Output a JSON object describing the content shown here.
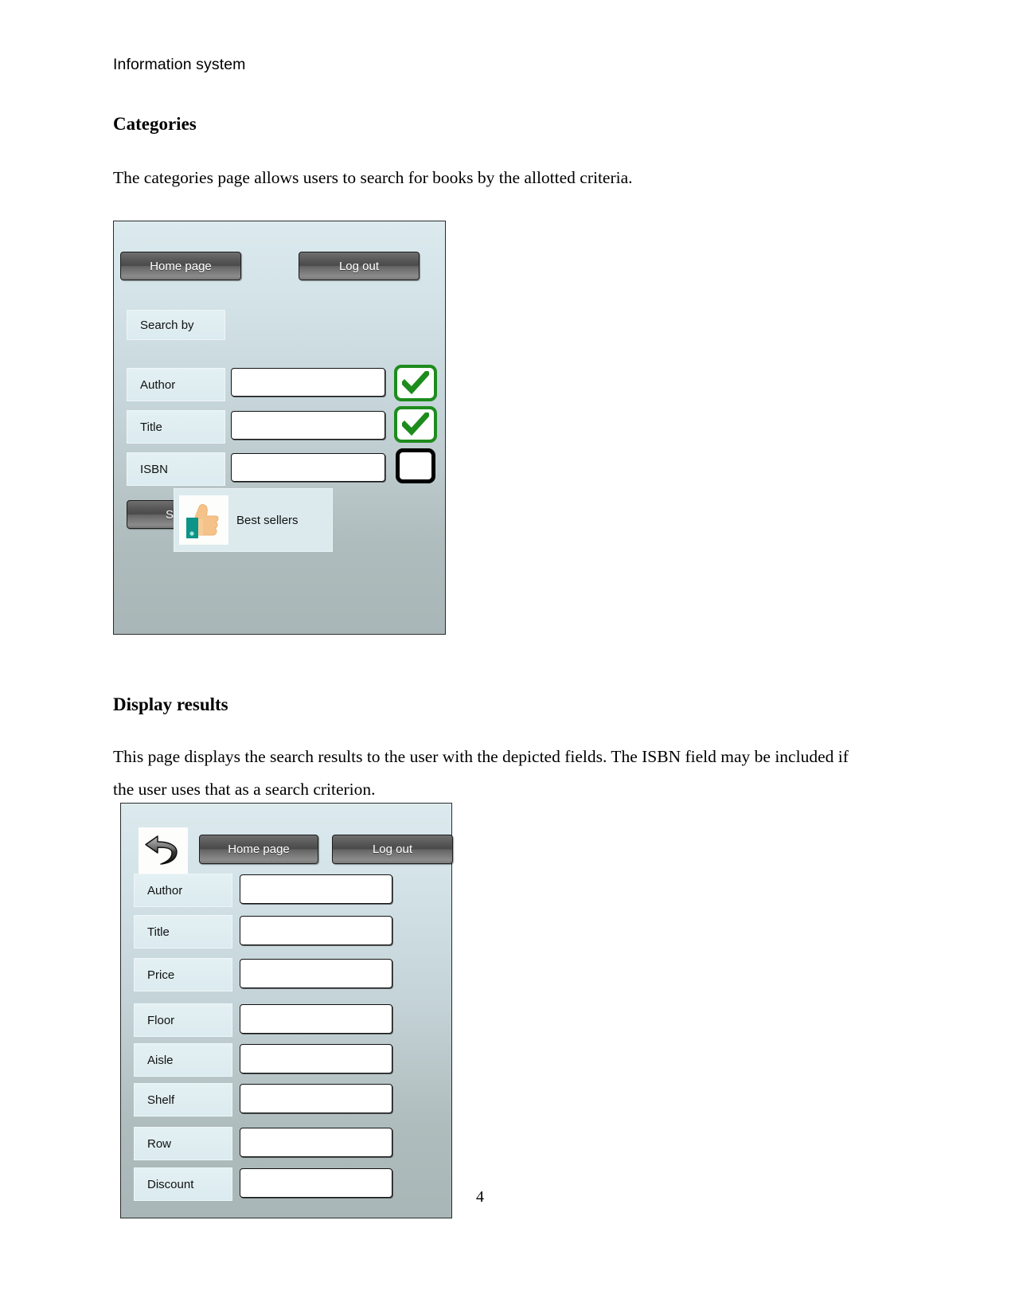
{
  "document": {
    "running_header": "Information system",
    "page_number": "4",
    "sections": [
      {
        "heading": "Categories",
        "paragraph": "The categories page allows users to search for books by the allotted criteria."
      },
      {
        "heading": "Display results",
        "paragraph": "This page displays the search results to the user with the depicted fields. The ISBN field may be included if the user uses that as a search criterion."
      }
    ]
  },
  "mockup_categories": {
    "name": "categories-screen",
    "buttons": {
      "home_page": "Home page",
      "log_out": "Log out",
      "search": "S"
    },
    "search_by_label": "Search by",
    "fields": [
      {
        "label": "Author",
        "value": "",
        "checkbox": "checked"
      },
      {
        "label": "Title",
        "value": "",
        "checkbox": "checked"
      },
      {
        "label": "ISBN",
        "value": "",
        "checkbox": "unchecked"
      }
    ],
    "best_sellers": {
      "label": "Best sellers",
      "icon": "thumbs-up-icon"
    }
  },
  "mockup_results": {
    "name": "display-results-screen",
    "back_icon": "back-arrow-icon",
    "buttons": {
      "home_page": "Home page",
      "log_out": "Log out"
    },
    "fields": [
      {
        "label": "Author",
        "value": ""
      },
      {
        "label": "Title",
        "value": ""
      },
      {
        "label": "Price",
        "value": ""
      },
      {
        "label": "Floor",
        "value": ""
      },
      {
        "label": "Aisle",
        "value": ""
      },
      {
        "label": "Shelf",
        "value": ""
      },
      {
        "label": "Row",
        "value": ""
      },
      {
        "label": "Discount",
        "value": ""
      }
    ]
  },
  "colors": {
    "panel_top": "#dceaee",
    "panel_bottom": "#a9b6b7",
    "chip": "#dfeef2",
    "button_dark": "#555555",
    "check_green": "#1d8c1d",
    "check_black": "#000000",
    "thumb_skin": "#f5c289",
    "thumb_cuff": "#0d9488"
  }
}
